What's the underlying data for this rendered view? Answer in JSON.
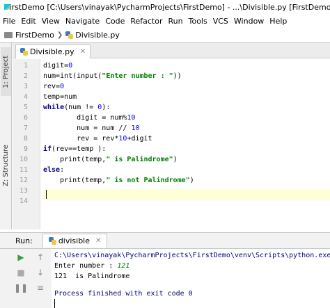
{
  "window": {
    "title": "FirstDemo [C:\\Users\\vinayak\\PycharmProjects\\FirstDemo] - ...\\Divisible.py [FirstDemo] - PyCharm"
  },
  "menu": [
    "File",
    "Edit",
    "View",
    "Navigate",
    "Code",
    "Refactor",
    "Run",
    "Tools",
    "VCS",
    "Window",
    "Help"
  ],
  "breadcrumb": {
    "project": "FirstDemo",
    "file": "Divisible.py"
  },
  "side_tabs": {
    "project": "1: Project",
    "structure": "Z: Structure"
  },
  "editor": {
    "tab_label": "Divisible.py",
    "line_numbers": [
      "1",
      "2",
      "3",
      "4",
      "5",
      "6",
      "7",
      "8",
      "9",
      "10",
      "11",
      "12",
      "13",
      "14"
    ],
    "lines": [
      "digit=0",
      "num=int(input(\"Enter number : \"))",
      "rev=0",
      "temp=num",
      "while(num != 0):",
      "        digit = num%10",
      "        num = num // 10",
      "        rev = rev*10+digit",
      "if(rev==temp ):",
      "    print(temp,\" is Palindrome\")",
      "else:",
      "    print(temp,\" is not Palindrome\")",
      "",
      ""
    ]
  },
  "run": {
    "label": "Run:",
    "tab": "divisible"
  },
  "console": {
    "path": "C:\\Users\\vinayak\\PycharmProjects\\FirstDemo\\venv\\Scripts\\python.exe",
    "prompt": "Enter number : ",
    "input": "121",
    "result": "121  is Palindrome",
    "finished": "Process finished with exit code 0"
  },
  "colors": {
    "keyword": "#000080",
    "string": "#008000",
    "number": "#0000ff",
    "current_line": "#ffffd7"
  }
}
